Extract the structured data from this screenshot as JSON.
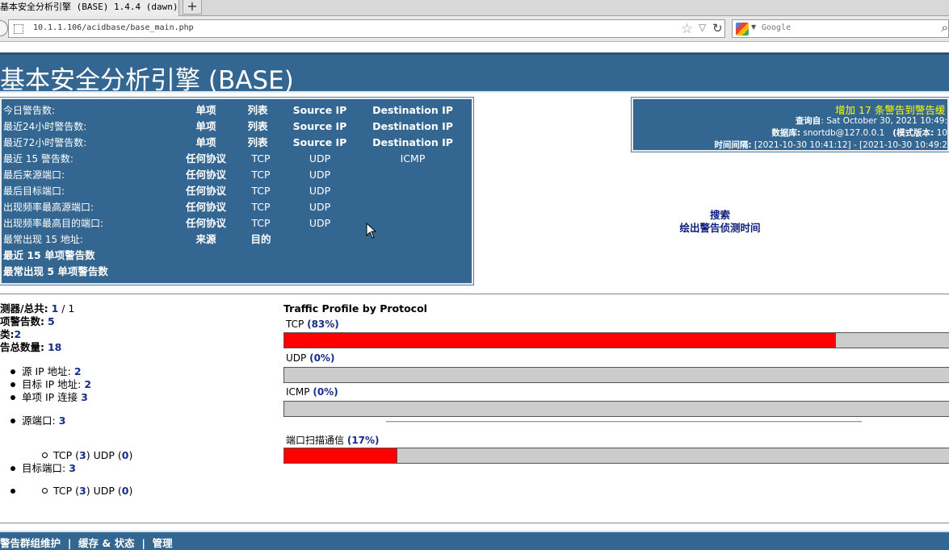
{
  "browser": {
    "tab_title": "基本安全分析引擎 (BASE) 1.4.4 (dawn)",
    "newtab_label": "+",
    "url": "10.1.1.106/acidbase/base_main.php",
    "search_placeholder": "Google"
  },
  "header": {
    "title": "基本安全分析引擎 (BASE)"
  },
  "queries": {
    "today": {
      "label": "今日警告数:",
      "l1": "单项",
      "l2": "列表",
      "l3": "Source IP",
      "l4": "Destination IP"
    },
    "last24": {
      "label": "最近24小时警告数:",
      "l1": "单项",
      "l2": "列表",
      "l3": "Source IP",
      "l4": "Destination IP"
    },
    "last72": {
      "label": "最近72小时警告数:",
      "l1": "单项",
      "l2": "列表",
      "l3": "Source IP",
      "l4": "Destination IP"
    },
    "last15": {
      "label": "最近 15 警告数:",
      "l1": "任何协议",
      "l2": "TCP",
      "l3": "UDP",
      "l4": "ICMP"
    },
    "src_port": {
      "label": "最后来源端口:",
      "l1": "任何协议",
      "l2": "TCP",
      "l3": "UDP"
    },
    "dst_port": {
      "label": "最后目标端口:",
      "l1": "任何协议",
      "l2": "TCP",
      "l3": "UDP"
    },
    "freq_src": {
      "label": "出现频率最高源端口:",
      "l1": "任何协议",
      "l2": "TCP",
      "l3": "UDP"
    },
    "freq_dst": {
      "label": "出现频率最高目的端口:",
      "l1": "任何协议",
      "l2": "TCP",
      "l3": "UDP"
    },
    "addr15": {
      "label": "最常出现 15 地址:",
      "l1": "来源",
      "l2": "目的"
    },
    "recent_unique": "最近 15 单项警告数",
    "frequent_unique": "最常出现 5 单项警告数"
  },
  "info": {
    "alert_msg": "增加 17 条警告到警告缓",
    "query_label": "查询自",
    "query_value": ": Sat October 30, 2021 10:49:",
    "db_label": "数据库:",
    "db_value": " snortdb@127.0.0.1",
    "schema_label": "(模式版本:",
    "schema_value": " 10",
    "time_label": "时间间隔:",
    "time_value": " [2021-10-30 10:41:12] - [2021-10-30 10:49:2"
  },
  "links": {
    "search": "搜索",
    "graph": "绘出警告侦测时间"
  },
  "stats": {
    "sensors_label": "测器/总共:",
    "sensors_value": "1",
    "sensors_total": " / 1",
    "unique_label": "项警告数:",
    "unique_value": "5",
    "category_label": "类:",
    "category_value": "2",
    "total_label": "告总数量:",
    "total_value": "18",
    "src_ip_label": "源 IP 地址:",
    "src_ip_value": "2",
    "dst_ip_label": "目标 IP 地址:",
    "dst_ip_value": "2",
    "unique_conn_label": "单项 IP 连接",
    "unique_conn_value": "3",
    "src_port_label": "源端口:",
    "src_port_value": "3",
    "src_tcp_label": "TCP (",
    "src_tcp_value": "3",
    "src_udp_label": ") UDP (",
    "src_udp_value": "0",
    "close_paren": ")",
    "dst_port_label": "目标端口:",
    "dst_port_value": "3",
    "dst_tcp_label": "TCP (",
    "dst_tcp_value": "3",
    "dst_udp_label": ") UDP (",
    "dst_udp_value": "0"
  },
  "traffic": {
    "title": "Traffic Profile by Protocol",
    "tcp_label": "TCP",
    "tcp_pct": "(83%)",
    "tcp_value": 83,
    "udp_label": "UDP",
    "udp_pct": "(0%)",
    "udp_value": 0,
    "icmp_label": "ICMP",
    "icmp_pct": "(0%)",
    "icmp_value": 0,
    "portscan_label": "端口扫描通信",
    "portscan_pct": "(17%)",
    "portscan_value": 17
  },
  "footer": {
    "item1": "警告群组维护",
    "sep": "|",
    "item2": "缓存 & 状态",
    "item3": "管理"
  },
  "colors": {
    "header_bg": "#336690",
    "bar_fill": "#ff0000",
    "bar_track": "#cccccc",
    "link": "#152e8a",
    "alert": "#ffff00"
  }
}
